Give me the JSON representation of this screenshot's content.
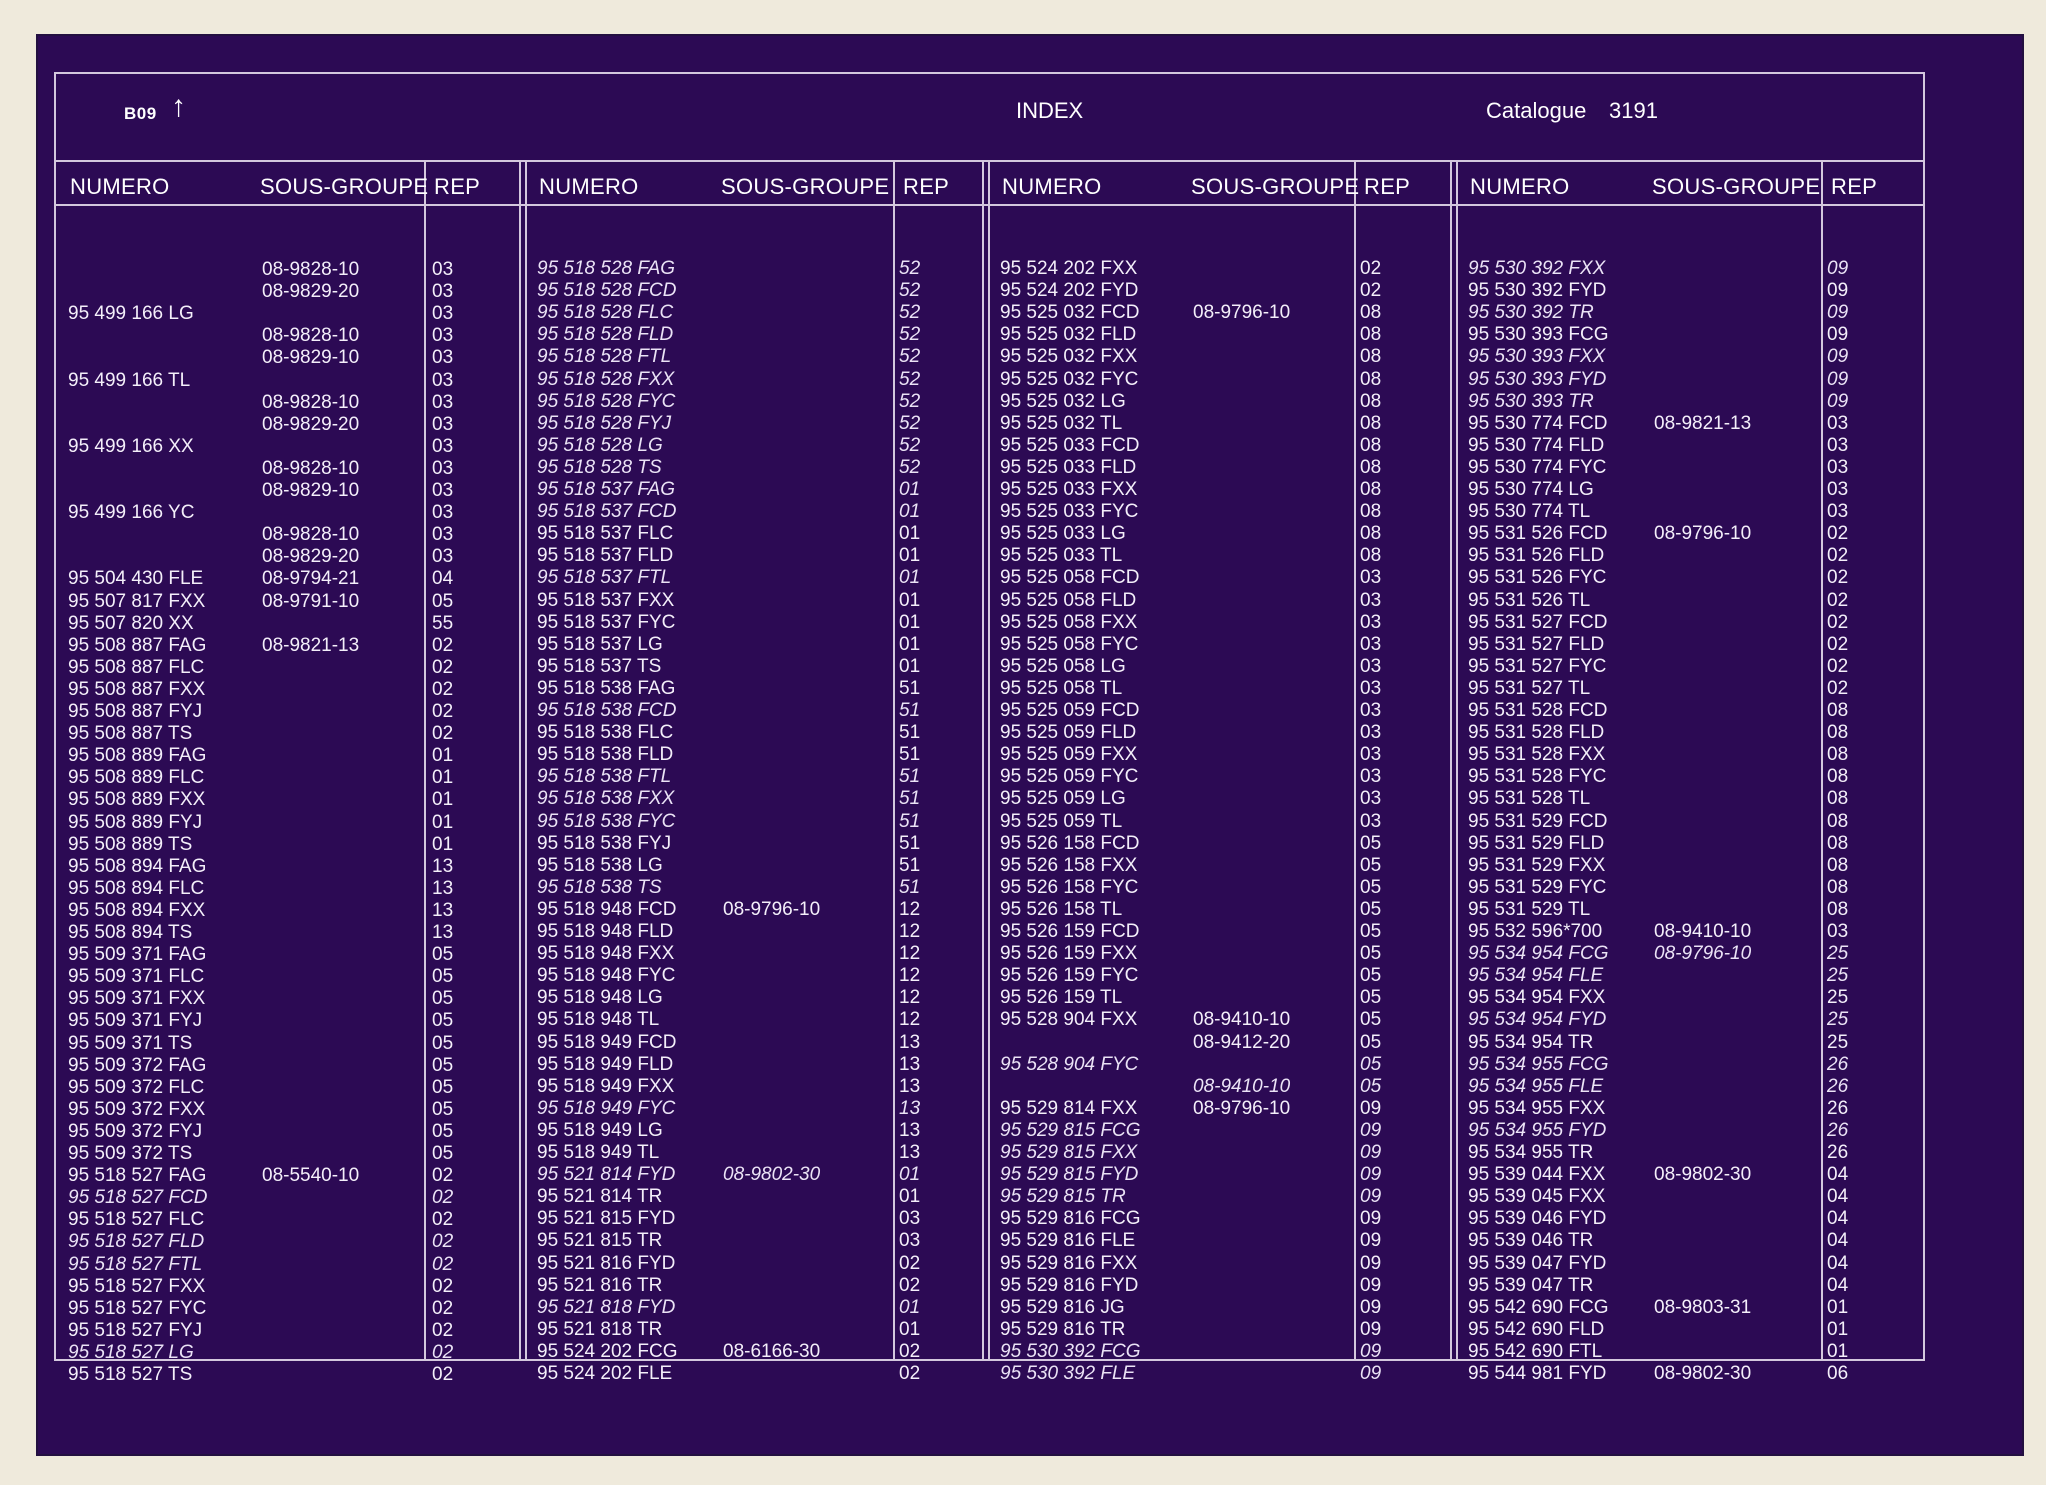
{
  "header": {
    "page": "B09",
    "arrow": "↑",
    "title": "INDEX",
    "catalogue_label": "Catalogue",
    "catalogue_number": "3191"
  },
  "columns": {
    "numero": "NUMERO",
    "sous_groupe": "SOUS-GROUPE",
    "rep": "REP"
  },
  "groups": [
    {
      "rows": [
        [
          "",
          "08-9828-10",
          "03",
          0
        ],
        [
          "",
          "08-9829-20",
          "03",
          0
        ],
        [
          "95 499 166 LG",
          "",
          "03",
          0
        ],
        [
          "",
          "08-9828-10",
          "03",
          0
        ],
        [
          "",
          "08-9829-10",
          "03",
          0
        ],
        [
          "95 499 166 TL",
          "",
          "03",
          0
        ],
        [
          "",
          "08-9828-10",
          "03",
          0
        ],
        [
          "",
          "08-9829-20",
          "03",
          0
        ],
        [
          "95 499 166 XX",
          "",
          "03",
          0
        ],
        [
          "",
          "08-9828-10",
          "03",
          0
        ],
        [
          "",
          "08-9829-10",
          "03",
          0
        ],
        [
          "95 499 166 YC",
          "",
          "03",
          0
        ],
        [
          "",
          "08-9828-10",
          "03",
          0
        ],
        [
          "",
          "08-9829-20",
          "03",
          0
        ],
        [
          "95 504 430 FLE",
          "08-9794-21",
          "04",
          0
        ],
        [
          "95 507 817 FXX",
          "08-9791-10",
          "05",
          0
        ],
        [
          "95 507 820 XX",
          "",
          "55",
          0
        ],
        [
          "95 508 887 FAG",
          "08-9821-13",
          "02",
          0
        ],
        [
          "95 508 887 FLC",
          "",
          "02",
          0
        ],
        [
          "95 508 887 FXX",
          "",
          "02",
          0
        ],
        [
          "95 508 887 FYJ",
          "",
          "02",
          0
        ],
        [
          "95 508 887 TS",
          "",
          "02",
          0
        ],
        [
          "95 508 889 FAG",
          "",
          "01",
          0
        ],
        [
          "95 508 889 FLC",
          "",
          "01",
          0
        ],
        [
          "95 508 889 FXX",
          "",
          "01",
          0
        ],
        [
          "95 508 889 FYJ",
          "",
          "01",
          0
        ],
        [
          "95 508 889 TS",
          "",
          "01",
          0
        ],
        [
          "95 508 894 FAG",
          "",
          "13",
          0
        ],
        [
          "95 508 894 FLC",
          "",
          "13",
          0
        ],
        [
          "95 508 894 FXX",
          "",
          "13",
          0
        ],
        [
          "95 508 894 TS",
          "",
          "13",
          0
        ],
        [
          "95 509 371 FAG",
          "",
          "05",
          0
        ],
        [
          "95 509 371 FLC",
          "",
          "05",
          0
        ],
        [
          "95 509 371 FXX",
          "",
          "05",
          0
        ],
        [
          "95 509 371 FYJ",
          "",
          "05",
          0
        ],
        [
          "95 509 371 TS",
          "",
          "05",
          0
        ],
        [
          "95 509 372 FAG",
          "",
          "05",
          0
        ],
        [
          "95 509 372 FLC",
          "",
          "05",
          0
        ],
        [
          "95 509 372 FXX",
          "",
          "05",
          0
        ],
        [
          "95 509 372 FYJ",
          "",
          "05",
          0
        ],
        [
          "95 509 372 TS",
          "",
          "05",
          0
        ],
        [
          "95 518 527 FAG",
          "08-5540-10",
          "02",
          0
        ],
        [
          "95 518 527 FCD",
          "",
          "02",
          1
        ],
        [
          "95 518 527 FLC",
          "",
          "02",
          0
        ],
        [
          "95 518 527 FLD",
          "",
          "02",
          1
        ],
        [
          "95 518 527 FTL",
          "",
          "02",
          1
        ],
        [
          "95 518 527 FXX",
          "",
          "02",
          0
        ],
        [
          "95 518 527 FYC",
          "",
          "02",
          0
        ],
        [
          "95 518 527 FYJ",
          "",
          "02",
          0
        ],
        [
          "95 518 527 LG",
          "",
          "02",
          1
        ],
        [
          "95 518 527 TS",
          "",
          "02",
          0
        ]
      ]
    },
    {
      "rows": [
        [
          "95 518 528 FAG",
          "",
          "52",
          1
        ],
        [
          "95 518 528 FCD",
          "",
          "52",
          1
        ],
        [
          "95 518 528 FLC",
          "",
          "52",
          1
        ],
        [
          "95 518 528 FLD",
          "",
          "52",
          1
        ],
        [
          "95 518 528 FTL",
          "",
          "52",
          1
        ],
        [
          "95 518 528 FXX",
          "",
          "52",
          1
        ],
        [
          "95 518 528 FYC",
          "",
          "52",
          1
        ],
        [
          "95 518 528 FYJ",
          "",
          "52",
          1
        ],
        [
          "95 518 528 LG",
          "",
          "52",
          1
        ],
        [
          "95 518 528 TS",
          "",
          "52",
          1
        ],
        [
          "95 518 537 FAG",
          "",
          "01",
          1
        ],
        [
          "95 518 537 FCD",
          "",
          "01",
          1
        ],
        [
          "95 518 537 FLC",
          "",
          "01",
          0
        ],
        [
          "95 518 537 FLD",
          "",
          "01",
          0
        ],
        [
          "95 518 537 FTL",
          "",
          "01",
          1
        ],
        [
          "95 518 537 FXX",
          "",
          "01",
          0
        ],
        [
          "95 518 537 FYC",
          "",
          "01",
          0
        ],
        [
          "95 518 537 LG",
          "",
          "01",
          0
        ],
        [
          "95 518 537 TS",
          "",
          "01",
          0
        ],
        [
          "95 518 538 FAG",
          "",
          "51",
          0
        ],
        [
          "95 518 538 FCD",
          "",
          "51",
          1
        ],
        [
          "95 518 538 FLC",
          "",
          "51",
          0
        ],
        [
          "95 518 538 FLD",
          "",
          "51",
          0
        ],
        [
          "95 518 538 FTL",
          "",
          "51",
          1
        ],
        [
          "95 518 538 FXX",
          "",
          "51",
          1
        ],
        [
          "95 518 538 FYC",
          "",
          "51",
          1
        ],
        [
          "95 518 538 FYJ",
          "",
          "51",
          0
        ],
        [
          "95 518 538 LG",
          "",
          "51",
          0
        ],
        [
          "95 518 538 TS",
          "",
          "51",
          1
        ],
        [
          "95 518 948 FCD",
          "08-9796-10",
          "12",
          0
        ],
        [
          "95 518 948 FLD",
          "",
          "12",
          0
        ],
        [
          "95 518 948 FXX",
          "",
          "12",
          0
        ],
        [
          "95 518 948 FYC",
          "",
          "12",
          0
        ],
        [
          "95 518 948 LG",
          "",
          "12",
          0
        ],
        [
          "95 518 948 TL",
          "",
          "12",
          0
        ],
        [
          "95 518 949 FCD",
          "",
          "13",
          0
        ],
        [
          "95 518 949 FLD",
          "",
          "13",
          0
        ],
        [
          "95 518 949 FXX",
          "",
          "13",
          0
        ],
        [
          "95 518 949 FYC",
          "",
          "13",
          1
        ],
        [
          "95 518 949 LG",
          "",
          "13",
          0
        ],
        [
          "95 518 949 TL",
          "",
          "13",
          0
        ],
        [
          "95 521 814 FYD",
          "08-9802-30",
          "01",
          1
        ],
        [
          "95 521 814 TR",
          "",
          "01",
          0
        ],
        [
          "95 521 815 FYD",
          "",
          "03",
          0
        ],
        [
          "95 521 815 TR",
          "",
          "03",
          0
        ],
        [
          "95 521 816 FYD",
          "",
          "02",
          0
        ],
        [
          "95 521 816 TR",
          "",
          "02",
          0
        ],
        [
          "95 521 818 FYD",
          "",
          "01",
          1
        ],
        [
          "95 521 818 TR",
          "",
          "01",
          0
        ],
        [
          "95 524 202 FCG",
          "08-6166-30",
          "02",
          0
        ],
        [
          "95 524 202 FLE",
          "",
          "02",
          0
        ]
      ]
    },
    {
      "rows": [
        [
          "95 524 202 FXX",
          "",
          "02",
          0
        ],
        [
          "95 524 202 FYD",
          "",
          "02",
          0
        ],
        [
          "95 525 032 FCD",
          "08-9796-10",
          "08",
          0
        ],
        [
          "95 525 032 FLD",
          "",
          "08",
          0
        ],
        [
          "95 525 032 FXX",
          "",
          "08",
          0
        ],
        [
          "95 525 032 FYC",
          "",
          "08",
          0
        ],
        [
          "95 525 032 LG",
          "",
          "08",
          0
        ],
        [
          "95 525 032 TL",
          "",
          "08",
          0
        ],
        [
          "95 525 033 FCD",
          "",
          "08",
          0
        ],
        [
          "95 525 033 FLD",
          "",
          "08",
          0
        ],
        [
          "95 525 033 FXX",
          "",
          "08",
          0
        ],
        [
          "95 525 033 FYC",
          "",
          "08",
          0
        ],
        [
          "95 525 033 LG",
          "",
          "08",
          0
        ],
        [
          "95 525 033 TL",
          "",
          "08",
          0
        ],
        [
          "95 525 058 FCD",
          "",
          "03",
          0
        ],
        [
          "95 525 058 FLD",
          "",
          "03",
          0
        ],
        [
          "95 525 058 FXX",
          "",
          "03",
          0
        ],
        [
          "95 525 058 FYC",
          "",
          "03",
          0
        ],
        [
          "95 525 058 LG",
          "",
          "03",
          0
        ],
        [
          "95 525 058 TL",
          "",
          "03",
          0
        ],
        [
          "95 525 059 FCD",
          "",
          "03",
          0
        ],
        [
          "95 525 059 FLD",
          "",
          "03",
          0
        ],
        [
          "95 525 059 FXX",
          "",
          "03",
          0
        ],
        [
          "95 525 059 FYC",
          "",
          "03",
          0
        ],
        [
          "95 525 059 LG",
          "",
          "03",
          0
        ],
        [
          "95 525 059 TL",
          "",
          "03",
          0
        ],
        [
          "95 526 158 FCD",
          "",
          "05",
          0
        ],
        [
          "95 526 158 FXX",
          "",
          "05",
          0
        ],
        [
          "95 526 158 FYC",
          "",
          "05",
          0
        ],
        [
          "95 526 158 TL",
          "",
          "05",
          0
        ],
        [
          "95 526 159 FCD",
          "",
          "05",
          0
        ],
        [
          "95 526 159 FXX",
          "",
          "05",
          0
        ],
        [
          "95 526 159 FYC",
          "",
          "05",
          0
        ],
        [
          "95 526 159 TL",
          "",
          "05",
          0
        ],
        [
          "95 528 904 FXX",
          "08-9410-10",
          "05",
          0
        ],
        [
          "",
          "08-9412-20",
          "05",
          0
        ],
        [
          "95 528 904 FYC",
          "",
          "05",
          1
        ],
        [
          "",
          "08-9410-10",
          "05",
          1
        ],
        [
          "95 529 814 FXX",
          "08-9796-10",
          "09",
          0
        ],
        [
          "95 529 815 FCG",
          "",
          "09",
          1
        ],
        [
          "95 529 815 FXX",
          "",
          "09",
          1
        ],
        [
          "95 529 815 FYD",
          "",
          "09",
          1
        ],
        [
          "95 529 815 TR",
          "",
          "09",
          1
        ],
        [
          "95 529 816 FCG",
          "",
          "09",
          0
        ],
        [
          "95 529 816 FLE",
          "",
          "09",
          0
        ],
        [
          "95 529 816 FXX",
          "",
          "09",
          0
        ],
        [
          "95 529 816 FYD",
          "",
          "09",
          0
        ],
        [
          "95 529 816 JG",
          "",
          "09",
          0
        ],
        [
          "95 529 816 TR",
          "",
          "09",
          0
        ],
        [
          "95 530 392 FCG",
          "",
          "09",
          1
        ],
        [
          "95 530 392 FLE",
          "",
          "09",
          1
        ]
      ]
    },
    {
      "rows": [
        [
          "95 530 392 FXX",
          "",
          "09",
          1
        ],
        [
          "95 530 392 FYD",
          "",
          "09",
          0
        ],
        [
          "95 530 392 TR",
          "",
          "09",
          1
        ],
        [
          "95 530 393 FCG",
          "",
          "09",
          0
        ],
        [
          "95 530 393 FXX",
          "",
          "09",
          1
        ],
        [
          "95 530 393 FYD",
          "",
          "09",
          1
        ],
        [
          "95 530 393 TR",
          "",
          "09",
          1
        ],
        [
          "95 530 774 FCD",
          "08-9821-13",
          "03",
          0
        ],
        [
          "95 530 774 FLD",
          "",
          "03",
          0
        ],
        [
          "95 530 774 FYC",
          "",
          "03",
          0
        ],
        [
          "95 530 774 LG",
          "",
          "03",
          0
        ],
        [
          "95 530 774 TL",
          "",
          "03",
          0
        ],
        [
          "95 531 526 FCD",
          "08-9796-10",
          "02",
          0
        ],
        [
          "95 531 526 FLD",
          "",
          "02",
          0
        ],
        [
          "95 531 526 FYC",
          "",
          "02",
          0
        ],
        [
          "95 531 526 TL",
          "",
          "02",
          0
        ],
        [
          "95 531 527 FCD",
          "",
          "02",
          0
        ],
        [
          "95 531 527 FLD",
          "",
          "02",
          0
        ],
        [
          "95 531 527 FYC",
          "",
          "02",
          0
        ],
        [
          "95 531 527 TL",
          "",
          "02",
          0
        ],
        [
          "95 531 528 FCD",
          "",
          "08",
          0
        ],
        [
          "95 531 528 FLD",
          "",
          "08",
          0
        ],
        [
          "95 531 528 FXX",
          "",
          "08",
          0
        ],
        [
          "95 531 528 FYC",
          "",
          "08",
          0
        ],
        [
          "95 531 528 TL",
          "",
          "08",
          0
        ],
        [
          "95 531 529 FCD",
          "",
          "08",
          0
        ],
        [
          "95 531 529 FLD",
          "",
          "08",
          0
        ],
        [
          "95 531 529 FXX",
          "",
          "08",
          0
        ],
        [
          "95 531 529 FYC",
          "",
          "08",
          0
        ],
        [
          "95 531 529 TL",
          "",
          "08",
          0
        ],
        [
          "95 532 596*700",
          "08-9410-10",
          "03",
          0
        ],
        [
          "95 534 954 FCG",
          "08-9796-10",
          "25",
          1
        ],
        [
          "95 534 954 FLE",
          "",
          "25",
          1
        ],
        [
          "95 534 954 FXX",
          "",
          "25",
          0
        ],
        [
          "95 534 954 FYD",
          "",
          "25",
          1
        ],
        [
          "95 534 954 TR",
          "",
          "25",
          0
        ],
        [
          "95 534 955 FCG",
          "",
          "26",
          1
        ],
        [
          "95 534 955 FLE",
          "",
          "26",
          1
        ],
        [
          "95 534 955 FXX",
          "",
          "26",
          0
        ],
        [
          "95 534 955 FYD",
          "",
          "26",
          1
        ],
        [
          "95 534 955 TR",
          "",
          "26",
          0
        ],
        [
          "95 539 044 FXX",
          "08-9802-30",
          "04",
          0
        ],
        [
          "95 539 045 FXX",
          "",
          "04",
          0
        ],
        [
          "95 539 046 FYD",
          "",
          "04",
          0
        ],
        [
          "95 539 046 TR",
          "",
          "04",
          0
        ],
        [
          "95 539 047 FYD",
          "",
          "04",
          0
        ],
        [
          "95 539 047 TR",
          "",
          "04",
          0
        ],
        [
          "95 542 690 FCG",
          "08-9803-31",
          "01",
          0
        ],
        [
          "95 542 690 FLD",
          "",
          "01",
          0
        ],
        [
          "95 542 690 FTL",
          "",
          "01",
          0
        ],
        [
          "95 544 981 FYD",
          "08-9802-30",
          "06",
          0
        ]
      ]
    }
  ]
}
